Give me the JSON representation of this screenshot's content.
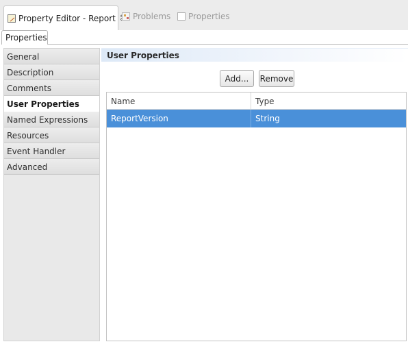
{
  "view_tabs": {
    "editor_title": "Property Editor - Report",
    "editor_close": "⌘",
    "problems_label": "Problems",
    "properties_label": "Properties"
  },
  "subtab": {
    "label": "Properties"
  },
  "categories": [
    {
      "label": "General",
      "selected": false
    },
    {
      "label": "Description",
      "selected": false
    },
    {
      "label": "Comments",
      "selected": false
    },
    {
      "label": "User Properties",
      "selected": true
    },
    {
      "label": "Named Expressions",
      "selected": false
    },
    {
      "label": "Resources",
      "selected": false
    },
    {
      "label": "Event Handler",
      "selected": false
    },
    {
      "label": "Advanced",
      "selected": false
    }
  ],
  "section": {
    "title": "User Properties"
  },
  "buttons": {
    "add_label": "Add...",
    "remove_label": "Remove"
  },
  "table": {
    "columns": [
      "Name",
      "Type"
    ],
    "rows": [
      {
        "name": "ReportVersion",
        "type": "String",
        "selected": true
      }
    ]
  },
  "colors": {
    "selection": "#4a90d9",
    "header_gradient": "#dde9f7"
  },
  "icons": {
    "editor": "report-editor-icon",
    "problems": "problems-icon",
    "properties": "properties-icon"
  }
}
